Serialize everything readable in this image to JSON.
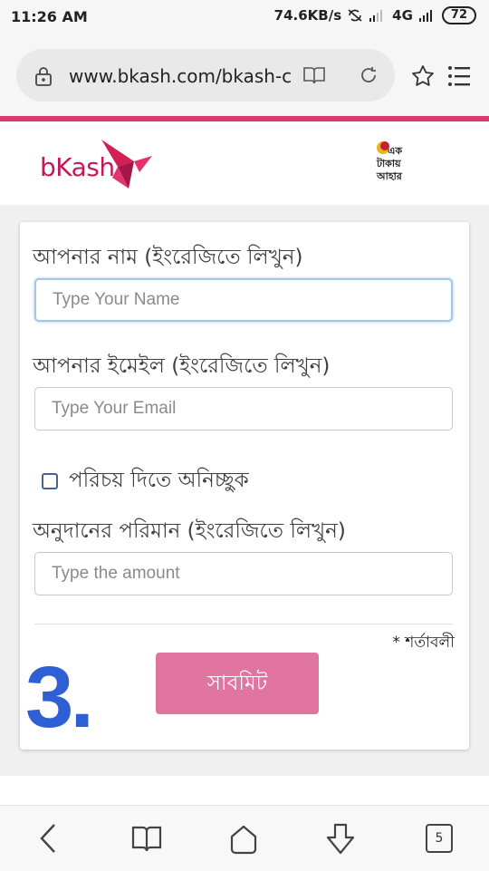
{
  "status_bar": {
    "time": "11:26 AM",
    "speed": "74.6KB/s",
    "network_type": "4G",
    "battery": "72"
  },
  "browser": {
    "url": "www.bkash.com/bkash-c",
    "tab_count": "5"
  },
  "header": {
    "logo_text": "bKash",
    "partner_logo_lines": [
      "এক",
      "টাকায়",
      "আহার"
    ]
  },
  "form": {
    "name_label": "আপনার নাম (ইংরেজিতে লিখুন)",
    "name_placeholder": "Type Your Name",
    "email_label": "আপনার ইমেইল (ইংরেজিতে লিখুন)",
    "email_placeholder": "Type Your Email",
    "anonymous_label": "পরিচয় দিতে অনিচ্ছুক",
    "amount_label": "অনুদানের পরিমান (ইংরেজিতে লিখুন)",
    "amount_placeholder": "Type the amount",
    "terms_label": "* শর্তাবলী",
    "submit_label": "সাবমিট"
  },
  "annotation": {
    "step": "3."
  },
  "colors": {
    "brand_pink": "#d9396b",
    "submit_bg": "#e076a0",
    "step_blue": "#2f5fd4"
  }
}
